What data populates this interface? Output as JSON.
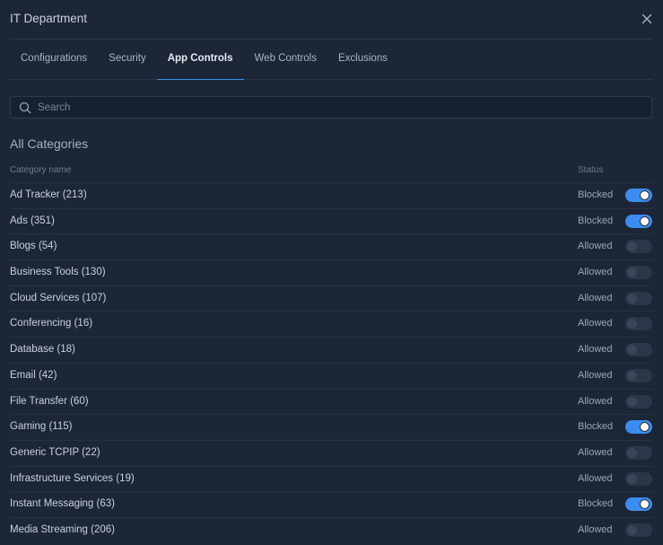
{
  "header": {
    "title": "IT Department"
  },
  "tabs": [
    {
      "label": "Configurations",
      "active": false
    },
    {
      "label": "Security",
      "active": false
    },
    {
      "label": "App Controls",
      "active": true
    },
    {
      "label": "Web Controls",
      "active": false
    },
    {
      "label": "Exclusions",
      "active": false
    }
  ],
  "search": {
    "placeholder": "Search",
    "value": ""
  },
  "section": {
    "title": "All Categories",
    "col_name": "Category name",
    "col_status": "Status"
  },
  "colors": {
    "background": "#1c2637",
    "accent": "#3b8cf0",
    "toggle_off": "#2b3648"
  },
  "categories": [
    {
      "name": "Ad Tracker (213)",
      "status": "Blocked",
      "enabled": true
    },
    {
      "name": "Ads (351)",
      "status": "Blocked",
      "enabled": true
    },
    {
      "name": "Blogs (54)",
      "status": "Allowed",
      "enabled": false
    },
    {
      "name": "Business Tools (130)",
      "status": "Allowed",
      "enabled": false
    },
    {
      "name": "Cloud Services (107)",
      "status": "Allowed",
      "enabled": false
    },
    {
      "name": "Conferencing (16)",
      "status": "Allowed",
      "enabled": false
    },
    {
      "name": "Database (18)",
      "status": "Allowed",
      "enabled": false
    },
    {
      "name": "Email (42)",
      "status": "Allowed",
      "enabled": false
    },
    {
      "name": "File Transfer (60)",
      "status": "Allowed",
      "enabled": false
    },
    {
      "name": "Gaming (115)",
      "status": "Blocked",
      "enabled": true
    },
    {
      "name": "Generic TCPIP (22)",
      "status": "Allowed",
      "enabled": false
    },
    {
      "name": "Infrastructure Services (19)",
      "status": "Allowed",
      "enabled": false
    },
    {
      "name": "Instant Messaging (63)",
      "status": "Blocked",
      "enabled": true
    },
    {
      "name": "Media Streaming (206)",
      "status": "Allowed",
      "enabled": false
    }
  ]
}
